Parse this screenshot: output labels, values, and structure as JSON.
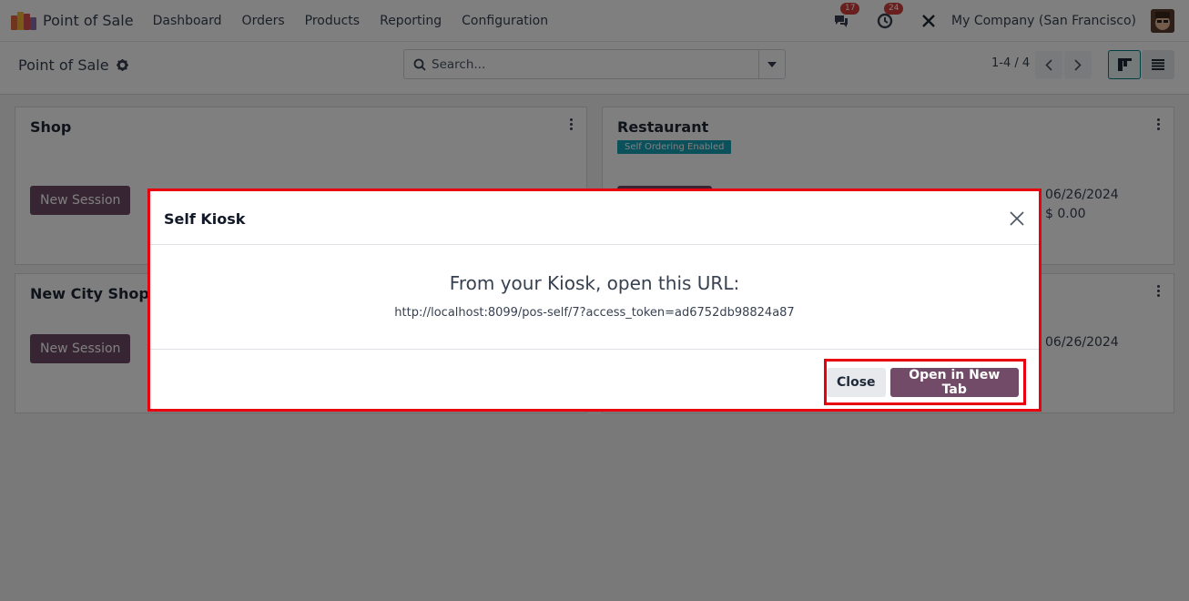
{
  "navbar": {
    "app_title": "Point of Sale",
    "menu": [
      "Dashboard",
      "Orders",
      "Products",
      "Reporting",
      "Configuration"
    ],
    "messages_count": "17",
    "activities_count": "24",
    "company": "My Company (San Francisco)",
    "icons": {
      "app": "pos-logo-icon",
      "messages": "chat-icon",
      "activities": "clock-icon",
      "debug": "tools-icon",
      "user": "avatar"
    }
  },
  "control_panel": {
    "breadcrumb": "Point of Sale",
    "search_placeholder": "Search...",
    "pager": "1-4 / 4"
  },
  "cards": [
    {
      "title": "Shop",
      "button": "New Session"
    },
    {
      "title": "Restaurant",
      "tag": "Self Ordering Enabled",
      "date": "06/26/2024",
      "amount": "$ 0.00"
    },
    {
      "title": "New City Shop",
      "button": "New Session"
    },
    {
      "title": "",
      "date": "06/26/2024"
    }
  ],
  "modal": {
    "title": "Self Kiosk",
    "heading": "From your Kiosk, open this URL:",
    "url": "http://localhost:8099/pos-self/7?access_token=ad6752db98824a87",
    "close_label": "Close",
    "open_label": "Open in New Tab"
  },
  "colors": {
    "brand": "#714b67",
    "highlight": "#e8000f",
    "tag": "#17a2b8",
    "badge": "#d23f3a"
  }
}
